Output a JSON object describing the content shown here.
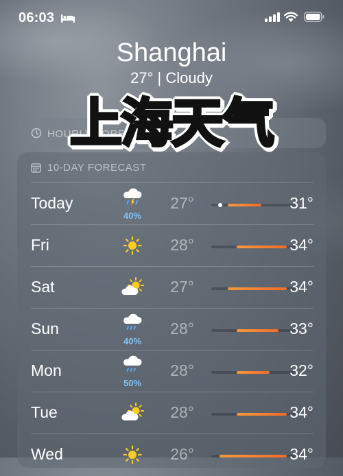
{
  "status": {
    "time": "06:03",
    "icons": [
      "bed-icon",
      "signal-icon",
      "wifi-icon",
      "battery-icon"
    ]
  },
  "header": {
    "city": "Shanghai",
    "condition": "27° | Cloudy"
  },
  "overlay_title": "上海天气",
  "hourly": {
    "label": "HOURLY FORECAST"
  },
  "forecast": {
    "title": "10-DAY FORECAST",
    "colors": {
      "precip": "#7cc6ff",
      "bar_start": "#f59a3c",
      "bar_end": "#f26b2a"
    },
    "days": [
      {
        "day": "Today",
        "icon": "thunderstorm-icon",
        "precip": "40%",
        "low": "27°",
        "high": "31°",
        "range_low": 27,
        "range_high": 31,
        "now": 27
      },
      {
        "day": "Fri",
        "icon": "sun-icon",
        "precip": "",
        "low": "28°",
        "high": "34°",
        "range_low": 28,
        "range_high": 34
      },
      {
        "day": "Sat",
        "icon": "partly-cloudy-icon",
        "precip": "",
        "low": "27°",
        "high": "34°",
        "range_low": 27,
        "range_high": 34
      },
      {
        "day": "Sun",
        "icon": "rain-icon",
        "precip": "40%",
        "low": "28°",
        "high": "33°",
        "range_low": 28,
        "range_high": 33
      },
      {
        "day": "Mon",
        "icon": "rain-icon",
        "precip": "50%",
        "low": "28°",
        "high": "32°",
        "range_low": 28,
        "range_high": 32
      },
      {
        "day": "Tue",
        "icon": "partly-cloudy-icon",
        "precip": "",
        "low": "28°",
        "high": "34°",
        "range_low": 28,
        "range_high": 34
      },
      {
        "day": "Wed",
        "icon": "sun-icon",
        "precip": "",
        "low": "26°",
        "high": "34°",
        "range_low": 26,
        "range_high": 34
      }
    ],
    "scale_min": 25,
    "scale_max": 35
  }
}
